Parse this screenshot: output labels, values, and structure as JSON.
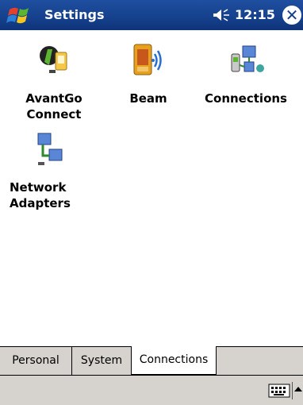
{
  "titlebar": {
    "title": "Settings",
    "time": "12:15",
    "start_icon": "windows-flag-icon",
    "volume_icon": "speaker-icon",
    "close_label": "✕"
  },
  "applets": [
    {
      "label": "AvantGo\nConnect",
      "icon": "avantgo-icon"
    },
    {
      "label": "Beam",
      "icon": "beam-icon"
    },
    {
      "label": "Connections",
      "icon": "connections-icon"
    },
    {
      "label": "Network\nAdapters",
      "icon": "network-adapters-icon"
    }
  ],
  "tabs": [
    {
      "label": "Personal"
    },
    {
      "label": "System"
    },
    {
      "label": "Connections",
      "active": true
    }
  ],
  "cmdbar": {
    "sip_icon": "keyboard-icon"
  },
  "colors": {
    "titlebar": "#15408c",
    "bar_gray": "#d6d3ce"
  }
}
